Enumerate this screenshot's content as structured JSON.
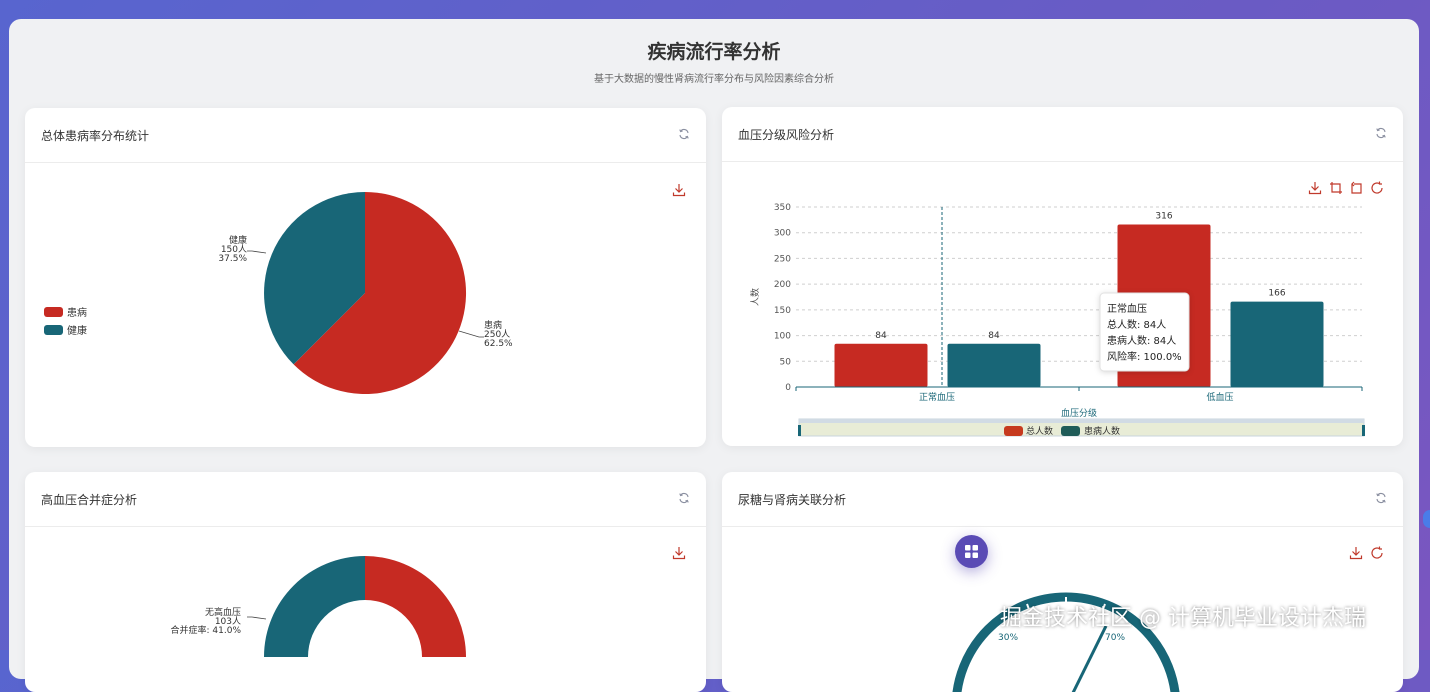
{
  "page": {
    "title": "疾病流行率分析",
    "subtitle": "基于大数据的慢性肾病流行率分布与风险因素综合分析"
  },
  "cards": {
    "overall": {
      "title": "总体患病率分布统计"
    },
    "bp": {
      "title": "血压分级风险分析"
    },
    "htn": {
      "title": "高血压合并症分析"
    },
    "sugar": {
      "title": "尿糖与肾病关联分析"
    }
  },
  "colors": {
    "red": "#c62a22",
    "teal": "#186677"
  },
  "icons": [
    "refresh-icon",
    "download-icon",
    "zoom-icon",
    "zoom-reset-icon",
    "restore-icon",
    "grid-icon"
  ],
  "charts": {
    "overall": {
      "type": "pie",
      "slices": [
        {
          "name": "患病",
          "value": 250,
          "value_label": "250人",
          "percent": "62.5%"
        },
        {
          "name": "健康",
          "value": 150,
          "value_label": "150人",
          "percent": "37.5%"
        }
      ],
      "legend": [
        "患病",
        "健康"
      ]
    },
    "bp": {
      "type": "bar",
      "categories": [
        "正常血压",
        "低血压"
      ],
      "series": [
        {
          "name": "总人数",
          "values": [
            84,
            316
          ]
        },
        {
          "name": "患病人数",
          "values": [
            84,
            166
          ]
        }
      ],
      "ylim": [
        0,
        350
      ],
      "y_ticks": [
        "0",
        "50",
        "100",
        "150",
        "200",
        "250",
        "300",
        "350"
      ],
      "ylabel": "人数",
      "xlabel": "血压分级",
      "tooltip": {
        "title": "正常血压",
        "line1": "总人数: 84人",
        "line2": "患病人数: 84人",
        "line3": "风险率: 100.0%"
      }
    },
    "htn": {
      "type": "pie",
      "label_line1": "无高血压",
      "label_line2": "103人",
      "label_line3": "合并症率: 41.0%"
    },
    "sugar": {
      "type": "gauge",
      "label_left": "30%",
      "label_right": "70%"
    }
  },
  "watermark": "掘金技术社区 @ 计算机毕业设计杰瑞"
}
